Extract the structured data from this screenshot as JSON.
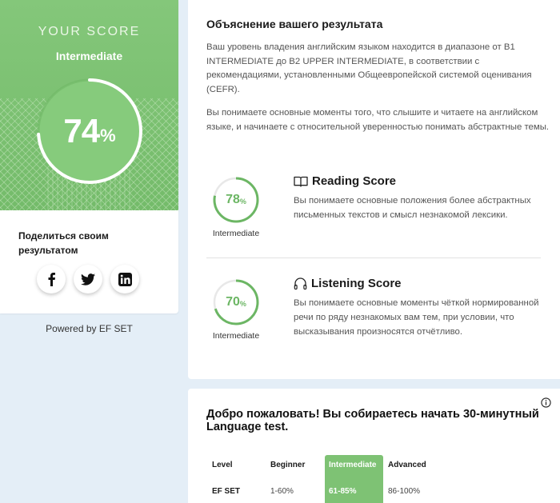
{
  "score_card": {
    "heading": "YOUR SCORE",
    "level": "Intermediate",
    "score": {
      "value": "74",
      "unit": "%",
      "fraction": 0.74
    },
    "share": {
      "title": "Поделиться своим результатом",
      "buttons": [
        {
          "name": "facebook",
          "icon": "facebook-icon"
        },
        {
          "name": "twitter",
          "icon": "twitter-icon"
        },
        {
          "name": "linkedin",
          "icon": "linkedin-icon"
        }
      ]
    }
  },
  "powered_by": "Powered by EF SET",
  "explanation": {
    "title": "Объяснение вашего результата",
    "paragraph1": "Ваш уровень владения английским языком находится в диапазоне от B1 INTERMEDIATE до B2 UPPER INTERMEDIATE, в соответствии с рекомендациями, установленными Общеевропейской системой оценивания (CEFR).",
    "paragraph2": "Вы понимаете основные моменты того, что слышите и читаете на английском языке, и начинаете с относительной уверенностью понимать абстрактные темы.",
    "skills": [
      {
        "id": "reading",
        "icon": "book-icon",
        "title": "Reading Score",
        "value": "78",
        "unit": "%",
        "fraction": 0.78,
        "level": "Intermediate",
        "description": "Вы понимаете основные положения более абстрактных письменных текстов и смысл незнакомой лексики."
      },
      {
        "id": "listening",
        "icon": "headphones-icon",
        "title": "Listening Score",
        "value": "70",
        "unit": "%",
        "fraction": 0.7,
        "level": "Intermediate",
        "description": "Вы понимаете основные моменты чёткой нормированной речи по ряду незнакомых вам тем, при условии, что высказывания произносятся отчётливо."
      }
    ]
  },
  "welcome": {
    "title": "Добро пожаловать! Вы собираетесь начать 30-минутный Language test.",
    "table": {
      "header": [
        "Level",
        "Beginner",
        "Intermediate",
        "Advanced"
      ],
      "row": [
        "EF SET",
        "1-60%",
        "61-85%",
        "86-100%"
      ],
      "highlighted_column": 2
    }
  },
  "colors": {
    "accent_green": "#7ec274",
    "ring_green": "#6cb664",
    "page_background": "#e4eef7"
  }
}
